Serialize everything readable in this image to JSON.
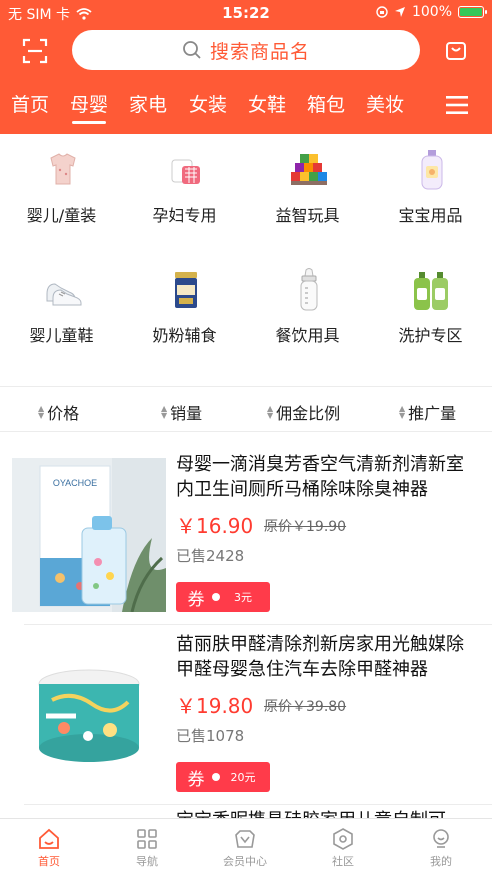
{
  "status": {
    "carrier": "无 SIM 卡",
    "time": "15:22",
    "battery": "100%"
  },
  "search": {
    "placeholder": "搜索商品名"
  },
  "tabs": [
    {
      "label": "首页"
    },
    {
      "label": "母婴"
    },
    {
      "label": "家电"
    },
    {
      "label": "女装"
    },
    {
      "label": "女鞋"
    },
    {
      "label": "箱包"
    },
    {
      "label": "美妆"
    }
  ],
  "categories": [
    {
      "label": "婴儿/童装",
      "icon": "baby-clothes-icon"
    },
    {
      "label": "孕妇专用",
      "icon": "maternity-icon"
    },
    {
      "label": "益智玩具",
      "icon": "toy-blocks-icon"
    },
    {
      "label": "宝宝用品",
      "icon": "baby-lotion-icon"
    },
    {
      "label": "婴儿童鞋",
      "icon": "baby-shoes-icon"
    },
    {
      "label": "奶粉辅食",
      "icon": "milk-powder-icon"
    },
    {
      "label": "餐饮用具",
      "icon": "baby-bottle-icon"
    },
    {
      "label": "洗护专区",
      "icon": "wash-care-icon"
    }
  ],
  "sort": [
    {
      "label": "价格"
    },
    {
      "label": "销量"
    },
    {
      "label": "佣金比例"
    },
    {
      "label": "推广量"
    }
  ],
  "products": [
    {
      "title": "母婴一滴消臭芳香空气清新剂清新室内卫生间厕所马桶除味除臭神器",
      "price": "￥16.90",
      "original": "原价￥19.90",
      "sold": "已售2428",
      "coupon_label": "券",
      "coupon_value": "3元",
      "brand": "OYACHOE"
    },
    {
      "title": "苗丽肤甲醛清除剂新房家用光触媒除甲醛母婴急住汽车去除甲醛神器",
      "price": "￥19.80",
      "original": "原价￥39.80",
      "sold": "已售1078",
      "coupon_label": "券",
      "coupon_value": "20元"
    },
    {
      "title": "宝宝香昵携具硅胶家用儿童自制可"
    }
  ],
  "tabbar": [
    {
      "label": "首页",
      "icon": "home-icon"
    },
    {
      "label": "导航",
      "icon": "grid-icon"
    },
    {
      "label": "会员中心",
      "icon": "member-icon"
    },
    {
      "label": "社区",
      "icon": "community-icon"
    },
    {
      "label": "我的",
      "icon": "profile-icon"
    }
  ],
  "colors": {
    "accent": "#ff5a36",
    "price": "#ff3b30",
    "coupon": "#ff3b4a"
  }
}
